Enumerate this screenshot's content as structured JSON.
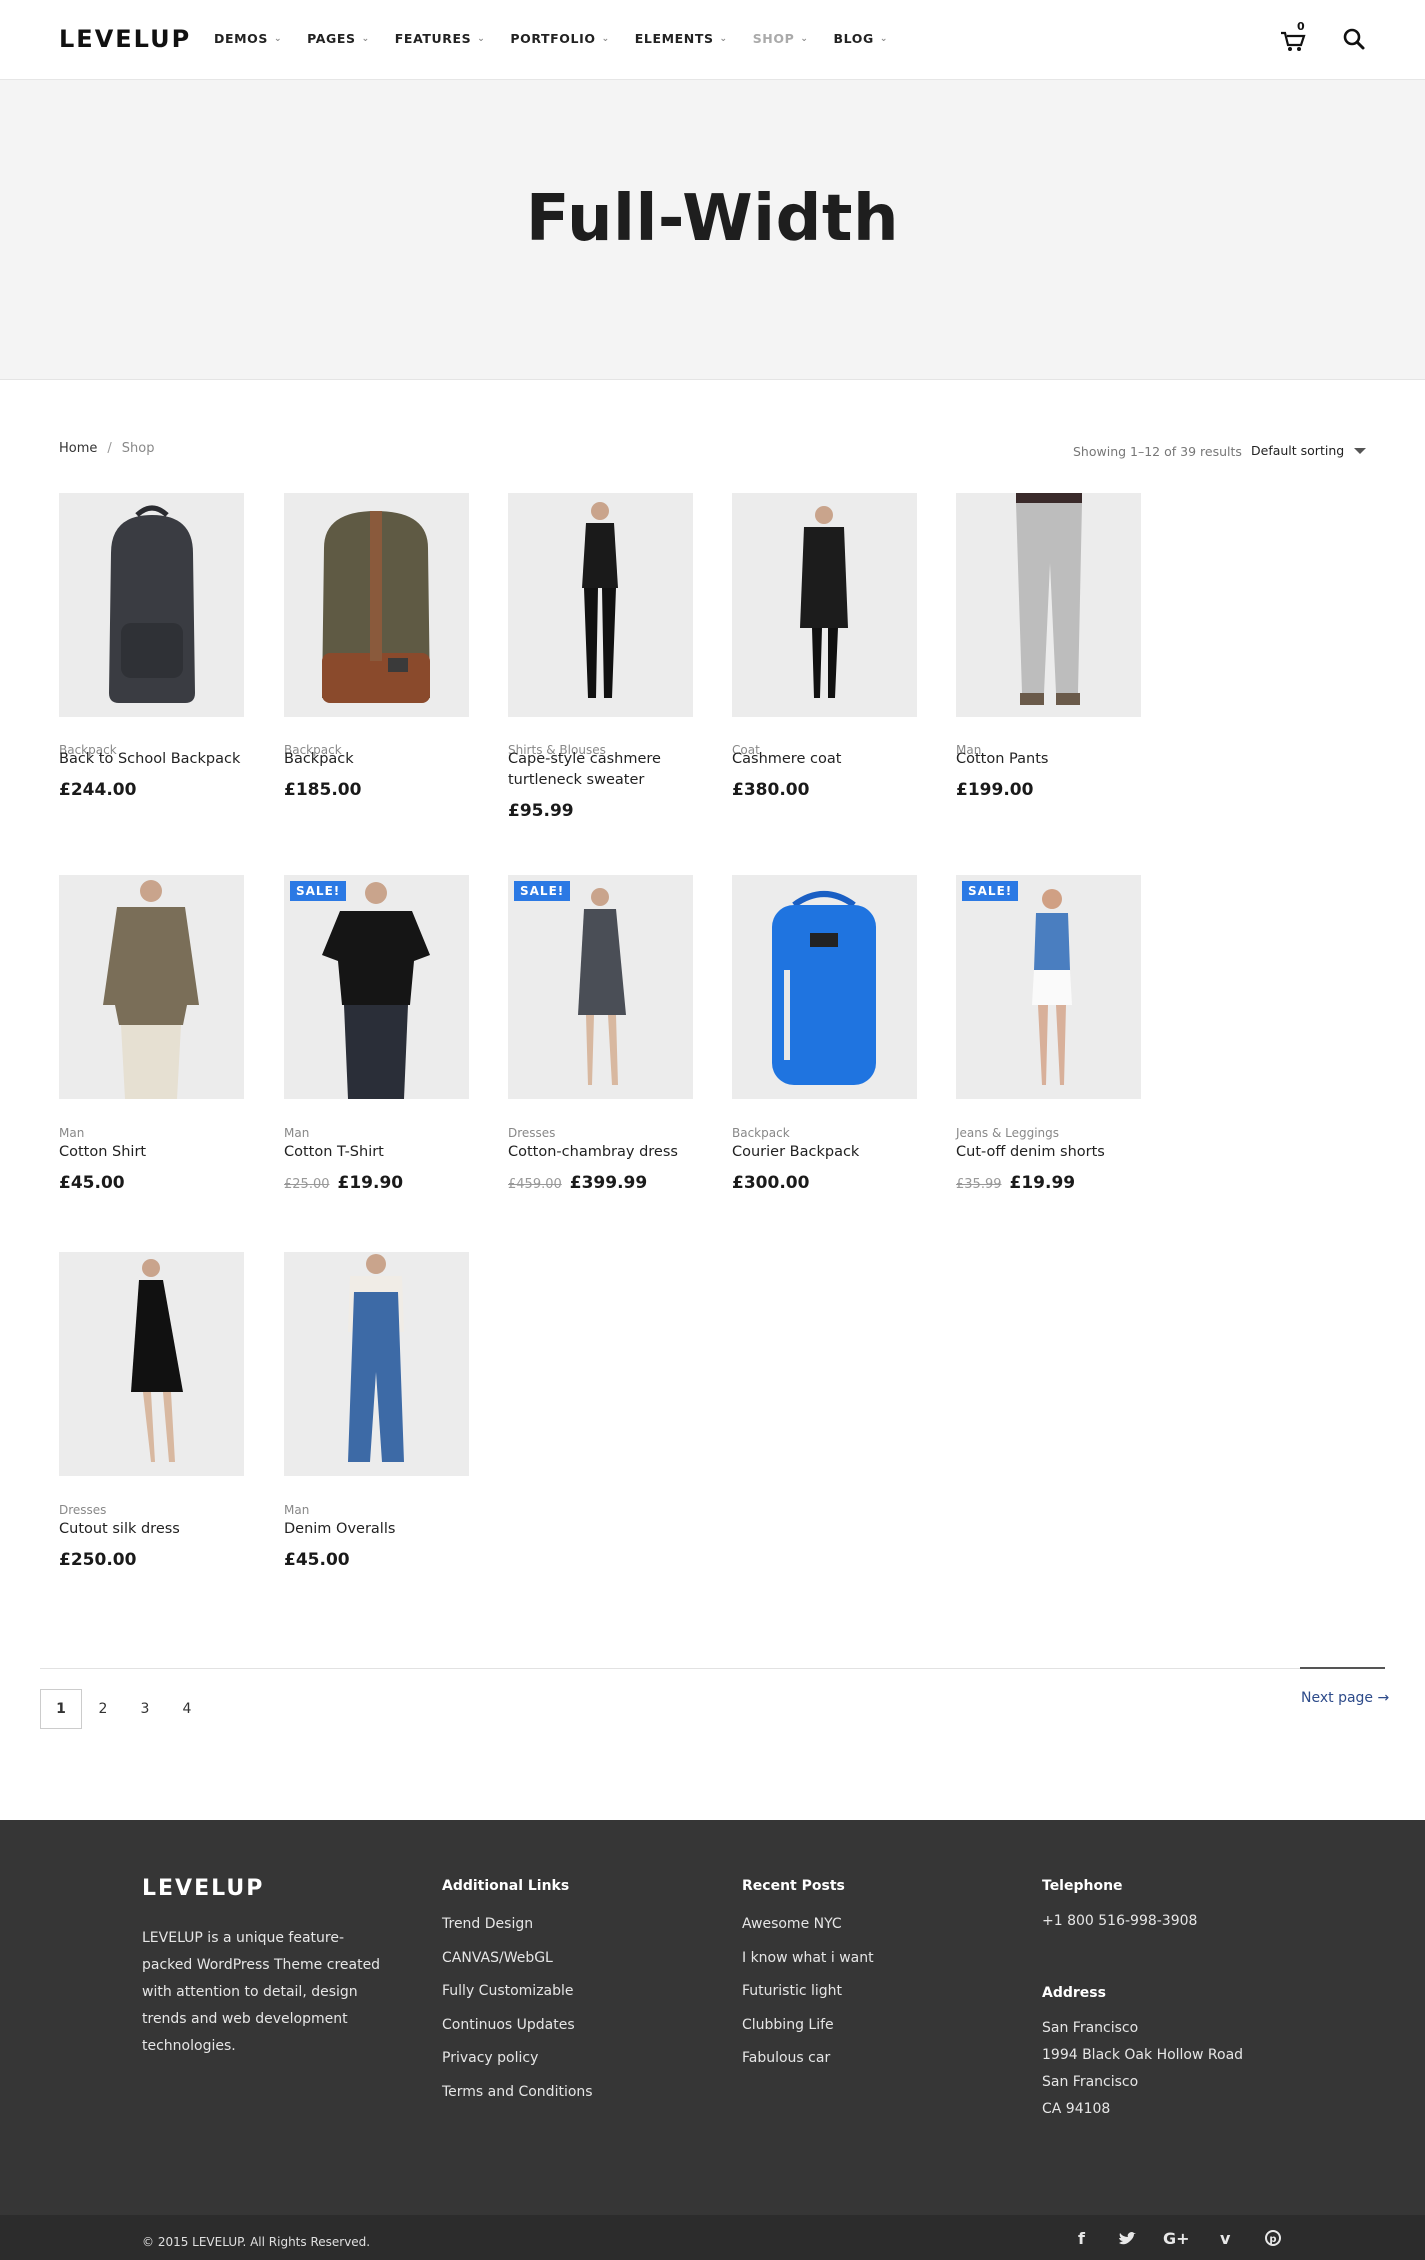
{
  "header": {
    "logo": "LEVELUP",
    "nav": [
      {
        "label": "DEMOS"
      },
      {
        "label": "PAGES"
      },
      {
        "label": "FEATURES"
      },
      {
        "label": "PORTFOLIO"
      },
      {
        "label": "ELEMENTS"
      },
      {
        "label": "SHOP"
      },
      {
        "label": "BLOG"
      }
    ],
    "cart_count": "0"
  },
  "hero": {
    "title": "Full-Width"
  },
  "breadcrumb": {
    "home": "Home",
    "sep": "/",
    "current": "Shop"
  },
  "shop": {
    "result_count": "Showing 1–12 of 39 results",
    "sort_label": "Default sorting"
  },
  "products": [
    {
      "category": "Backpack",
      "title": "Back to School Backpack",
      "price": "£244.00",
      "old_price": "",
      "sale": ""
    },
    {
      "category": "Backpack",
      "title": "Backpack",
      "price": "£185.00",
      "old_price": "",
      "sale": ""
    },
    {
      "category": "Shirts & Blouses",
      "title": "Cape-style cashmere turtleneck sweater",
      "price": "£95.99",
      "old_price": "",
      "sale": ""
    },
    {
      "category": "Coat",
      "title": "Cashmere coat",
      "price": "£380.00",
      "old_price": "",
      "sale": ""
    },
    {
      "category": "Man",
      "title": "Cotton Pants",
      "price": "£199.00",
      "old_price": "",
      "sale": ""
    },
    {
      "category": "Man",
      "title": "Cotton Shirt",
      "price": "£45.00",
      "old_price": "",
      "sale": ""
    },
    {
      "category": "Man",
      "title": "Cotton T-Shirt",
      "price": "£19.90",
      "old_price": "£25.00",
      "sale": "SALE!"
    },
    {
      "category": "Dresses",
      "title": "Cotton-chambray dress",
      "price": "£399.99",
      "old_price": "£459.00",
      "sale": "SALE!"
    },
    {
      "category": "Backpack",
      "title": "Courier Backpack",
      "price": "£300.00",
      "old_price": "",
      "sale": ""
    },
    {
      "category": "Jeans & Leggings",
      "title": "Cut-off denim shorts",
      "price": "£19.99",
      "old_price": "£35.99",
      "sale": "SALE!"
    },
    {
      "category": "Dresses",
      "title": "Cutout silk dress",
      "price": "£250.00",
      "old_price": "",
      "sale": ""
    },
    {
      "category": "Man",
      "title": "Denim Overalls",
      "price": "£45.00",
      "old_price": "",
      "sale": ""
    }
  ],
  "pagination": {
    "pages": [
      "1",
      "2",
      "3",
      "4"
    ],
    "next": "Next page →"
  },
  "footer": {
    "logo": "LEVELUP",
    "about": "LEVELUP is a unique feature-packed WordPress Theme created with attention to detail, design trends and web development technologies.",
    "links_heading": "Additional Links",
    "links": [
      "Trend Design",
      "CANVAS/WebGL",
      "Fully Customizable",
      "Continuos Updates",
      "Privacy policy",
      "Terms and Conditions"
    ],
    "posts_heading": "Recent Posts",
    "posts": [
      "Awesome NYC",
      "I know what i want",
      "Futuristic light",
      "Clubbing Life",
      "Fabulous car"
    ],
    "telephone_heading": "Telephone",
    "telephone": "+1 800 516-998-3908",
    "address_heading": "Address",
    "address": [
      "San Francisco",
      "1994 Black Oak Hollow Road",
      "San Francisco",
      "CA 94108"
    ],
    "copyright": "© 2015 LEVELUP. All Rights Reserved.",
    "social": [
      "f",
      "twitter-bird",
      "G+",
      "v",
      "p"
    ]
  },
  "colors": {
    "sale_badge": "#2b79e4",
    "footer_bg": "#363636",
    "link_blue": "#2d4b8a"
  }
}
